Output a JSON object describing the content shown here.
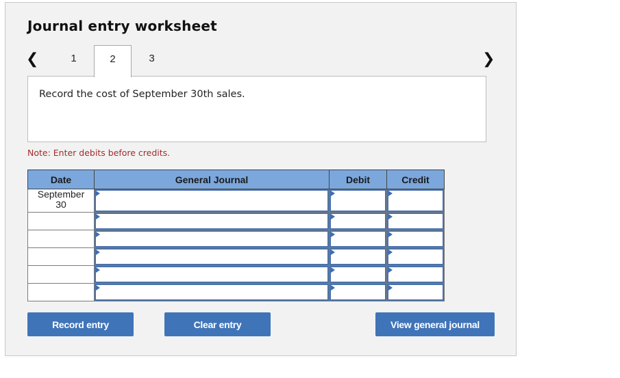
{
  "worksheet": {
    "title": "Journal entry worksheet",
    "nav": {
      "prev_icon": "‹",
      "next_icon": "›"
    },
    "tabs": [
      {
        "label": "1",
        "active": false
      },
      {
        "label": "2",
        "active": true
      },
      {
        "label": "3",
        "active": false
      }
    ],
    "instruction": "Record the cost of September 30th sales.",
    "note": "Note: Enter debits before credits."
  },
  "table": {
    "headers": {
      "date": "Date",
      "general_journal": "General Journal",
      "debit": "Debit",
      "credit": "Credit"
    },
    "rows": [
      {
        "date_line1": "September",
        "date_line2": "30",
        "account": "",
        "debit": "",
        "credit": ""
      },
      {
        "date_line1": "",
        "date_line2": "",
        "account": "",
        "debit": "",
        "credit": ""
      },
      {
        "date_line1": "",
        "date_line2": "",
        "account": "",
        "debit": "",
        "credit": ""
      },
      {
        "date_line1": "",
        "date_line2": "",
        "account": "",
        "debit": "",
        "credit": ""
      },
      {
        "date_line1": "",
        "date_line2": "",
        "account": "",
        "debit": "",
        "credit": ""
      },
      {
        "date_line1": "",
        "date_line2": "",
        "account": "",
        "debit": "",
        "credit": ""
      }
    ]
  },
  "buttons": {
    "record": "Record entry",
    "clear": "Clear entry",
    "view": "View general journal"
  },
  "colors": {
    "header_blue": "#7ba7dc",
    "button_blue": "#3f74b8",
    "note_red": "#a52a2a",
    "input_border": "#4a72aa"
  }
}
